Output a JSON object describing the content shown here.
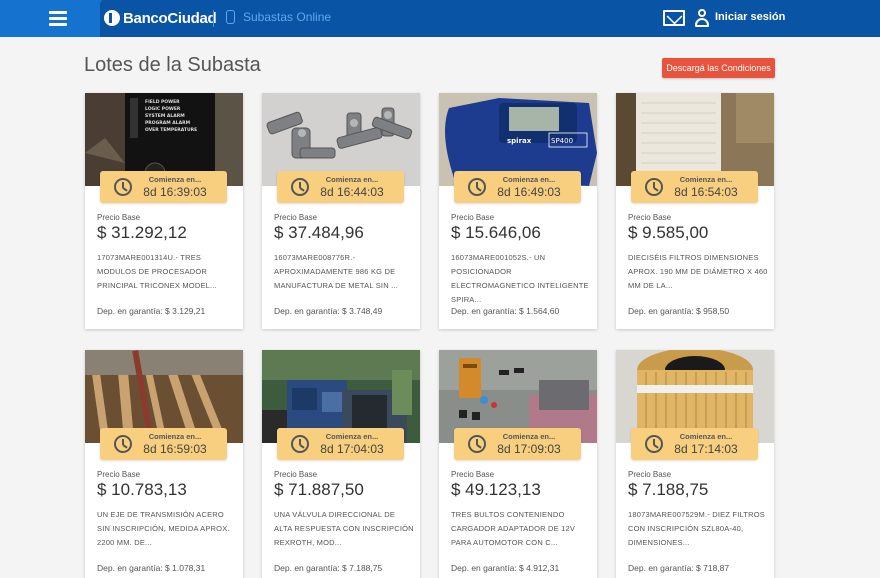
{
  "header": {
    "brand": "BancoCiudad",
    "section": "Subastas Online",
    "login": "Iniciar sesión",
    "bg_color": "#0a54a5",
    "accent_color": "#1573cf"
  },
  "page": {
    "title": "Lotes de la Subasta",
    "conditions_button": "Descargá las Condiciones",
    "button_color": "#e8533d"
  },
  "card_labels": {
    "timer": "Comienza en...",
    "price": "Precio Base",
    "guarantee_prefix": "Dep. en garantía: "
  },
  "lots": [
    {
      "countdown": "8d 16:39:03",
      "price": "$ 31.292,12",
      "description": "17073MARE001314U.- TRES MODULOS DE PROCESADOR PRINCIPAL TRICONEX MODEL...",
      "guarantee": "Dep. en garantía: $ 3.129,21",
      "image": "control-panel"
    },
    {
      "countdown": "8d 16:44:03",
      "price": "$ 37.484,96",
      "description": "16073MARE008776R.- APROXIMADAMENTE 986 KG DE MANUFACTURA DE METAL SIN ...",
      "guarantee": "Dep. en garantía: $ 3.748,49",
      "image": "metal-parts"
    },
    {
      "countdown": "8d 16:49:03",
      "price": "$ 15.646,06",
      "description": "16073MARE001052S.- UN POSICIONADOR ELECTROMAGNETICO INTELIGENTE SPIRA...",
      "guarantee": "Dep. en garantía: $ 1.564,60",
      "image": "positioner"
    },
    {
      "countdown": "8d 16:54:03",
      "price": "$ 9.585,00",
      "description": "DIECISÉIS FILTROS DIMENSIONES APROX. 190 MM DE DIÁMETRO X 460 MM DE LA...",
      "guarantee": "Dep. en garantía: $ 958,50",
      "image": "filters"
    },
    {
      "countdown": "8d 16:59:03",
      "price": "$ 10.783,13",
      "description": "UN EJE DE TRANSMISIÓN ACERO SIN INSCRIPCIÓN, MEDIDA APROX. 2200 MM. DE...",
      "guarantee": "Dep. en garantía: $ 1.078,31",
      "image": "shaft"
    },
    {
      "countdown": "8d 17:04:03",
      "price": "$ 71.887,50",
      "description": "UNA VÁLVULA DIRECCIONAL DE ALTA RESPUESTA CON INSCRIPCIÓN REXROTH, MOD...",
      "guarantee": "Dep. en garantía: $ 7.188,75",
      "image": "valve"
    },
    {
      "countdown": "8d 17:09:03",
      "price": "$ 49.123,13",
      "description": "TRES BULTOS CONTENIENDO CARGADOR ADAPTADOR DE 12V PARA AUTOMOTOR CON C...",
      "guarantee": "Dep. en garantía: $ 4.912,31",
      "image": "chargers"
    },
    {
      "countdown": "8d 17:14:03",
      "price": "$ 7.188,75",
      "description": "18073MARE007529M.- DIEZ FILTROS CON INSCRIPCIÓN SZL80A-40, DIMENSIONES...",
      "guarantee": "Dep. en garantía: $ 718,87",
      "image": "round-filter"
    }
  ],
  "colors": {
    "timer_bg": "#f8cf7e",
    "page_bg": "#f4f4f4"
  }
}
